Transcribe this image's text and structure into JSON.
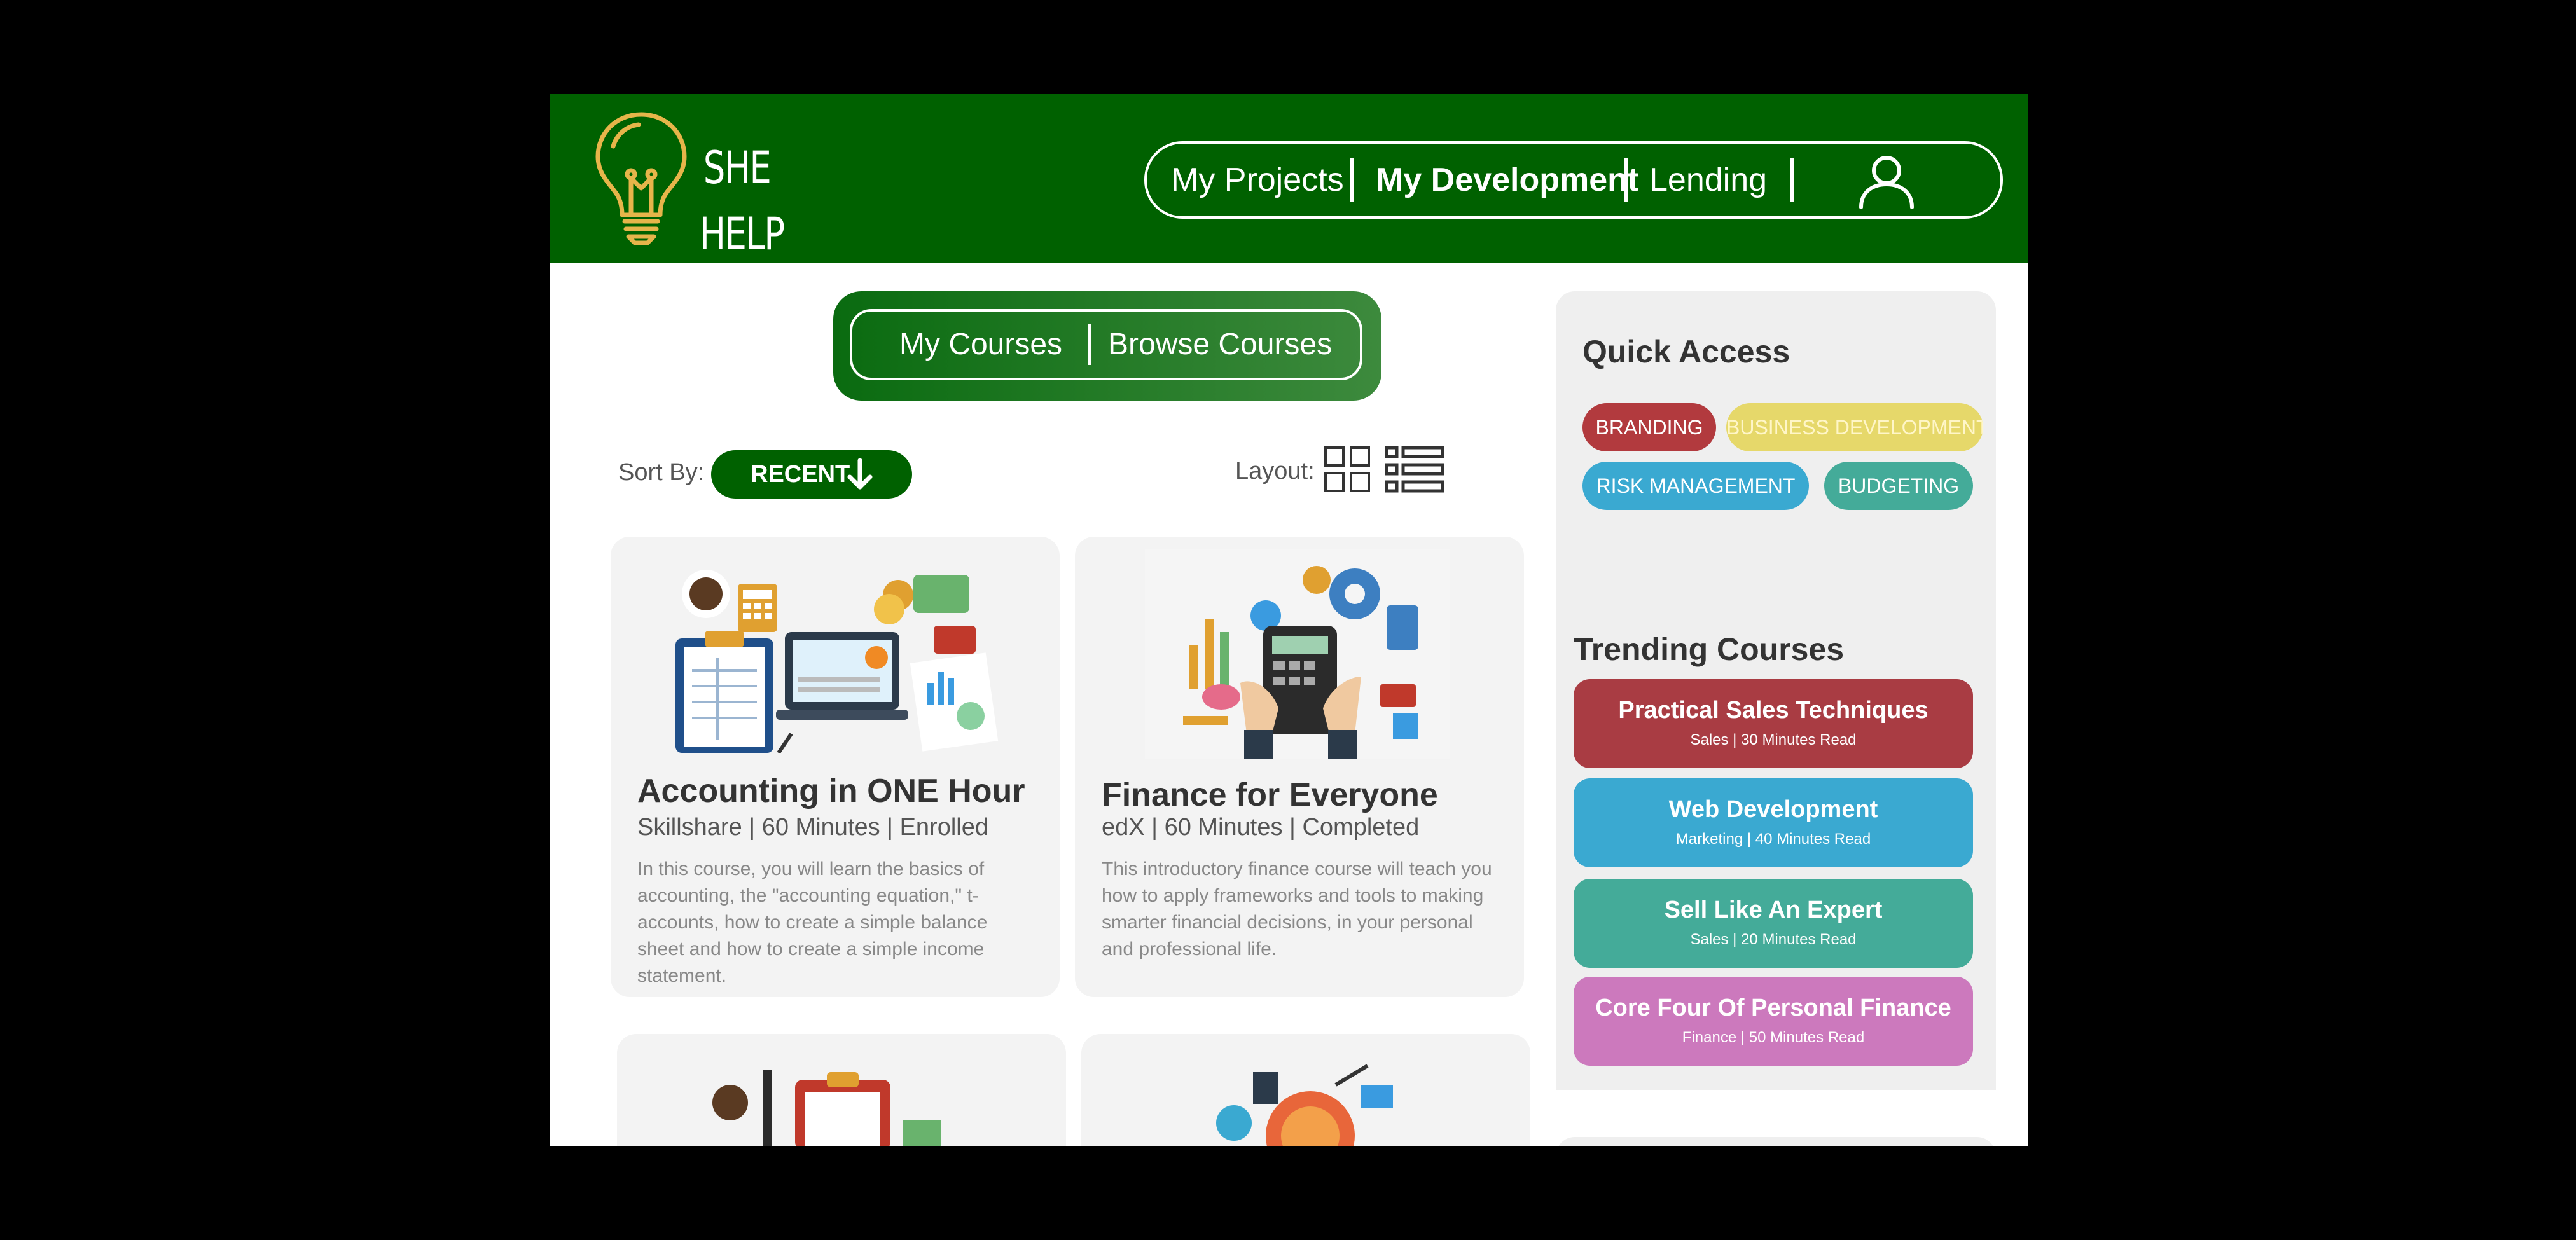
{
  "logo": {
    "line1": "SHE",
    "line2": "HELP"
  },
  "nav": {
    "items": [
      "My Projects",
      "My Development",
      "Lending"
    ],
    "active": "My Development"
  },
  "course_tabs": {
    "my_courses": "My Courses",
    "browse_courses": "Browse Courses"
  },
  "sort": {
    "label": "Sort By:",
    "value": "RECENT"
  },
  "layout": {
    "label": "Layout:"
  },
  "courses": [
    {
      "title": "Accounting in ONE Hour",
      "meta": "Skillshare | 60 Minutes | Enrolled",
      "description": "In this course, you will learn the basics of accounting, the \"accounting equation,\" t-accounts, how to create a simple balance sheet and how to create a simple income statement."
    },
    {
      "title": "Finance for Everyone",
      "meta": "edX | 60 Minutes | Completed",
      "description": "This introductory finance course will teach you how to apply frameworks and tools to making smarter financial decisions, in your personal and professional life."
    }
  ],
  "quick_access": {
    "title": "Quick Access",
    "tags": [
      {
        "label": "BRANDING",
        "color": "#b23a3e"
      },
      {
        "label": "BUSINESS DEVELOPMENT",
        "color": "#e6d86a"
      },
      {
        "label": "RISK MANAGEMENT",
        "color": "#3aa9d1"
      },
      {
        "label": "BUDGETING",
        "color": "#44ab99"
      }
    ]
  },
  "trending": {
    "title": "Trending Courses",
    "items": [
      {
        "title": "Practical Sales Techniques",
        "sub": "Sales | 30 Minutes Read",
        "color": "#a93c43"
      },
      {
        "title": "Web Development",
        "sub": "Marketing | 40 Minutes Read",
        "color": "#3aa9d1"
      },
      {
        "title": "Sell Like An Expert",
        "sub": "Sales | 20 Minutes Read",
        "color": "#44ab99"
      },
      {
        "title": "Core Four Of Personal Finance",
        "sub": "Finance | 50 Minutes Read",
        "color": "#cc79bd"
      }
    ]
  },
  "colors": {
    "brand_green": "#006100",
    "logo_gold": "#e6b54a"
  }
}
